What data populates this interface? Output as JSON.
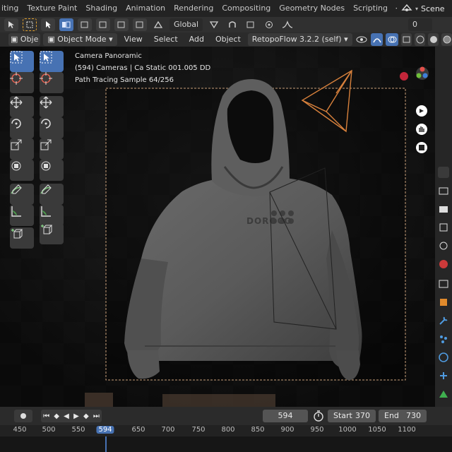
{
  "topbar": {
    "tabs": [
      "iting",
      "Texture Paint",
      "Shading",
      "Animation",
      "Rendering",
      "Compositing",
      "Geometry Nodes",
      "Scripting"
    ],
    "add_label": "+",
    "scene_label": "Scene"
  },
  "header1": {
    "transform_orientation": "Global",
    "right_value": "0"
  },
  "header2": {
    "object_short": "Obje",
    "mode": "Object Mode",
    "menus": [
      "View",
      "Select",
      "Add",
      "Object"
    ],
    "addon": "RetopoFlow 3.2.2 (self)"
  },
  "viewport": {
    "overlay_title": "Camera Panoramic",
    "overlay_line2": "(594) Cameras | Ca Static 001.005 DD",
    "overlay_line3": "Path Tracing Sample 64/256",
    "garment_logo": "DOROCO",
    "colors": {
      "camera_outline": "#d8813c",
      "frame_border": "#c9a07a",
      "record_dot": "#c3263a"
    }
  },
  "timeline": {
    "current_frame": "594",
    "start_label": "Start",
    "start_value": "370",
    "end_label": "End",
    "end_value": "730",
    "ruler_ticks": [
      "450",
      "500",
      "550",
      "594",
      "650",
      "700",
      "750",
      "800",
      "850",
      "900",
      "950",
      "1000",
      "1050",
      "1100"
    ]
  }
}
